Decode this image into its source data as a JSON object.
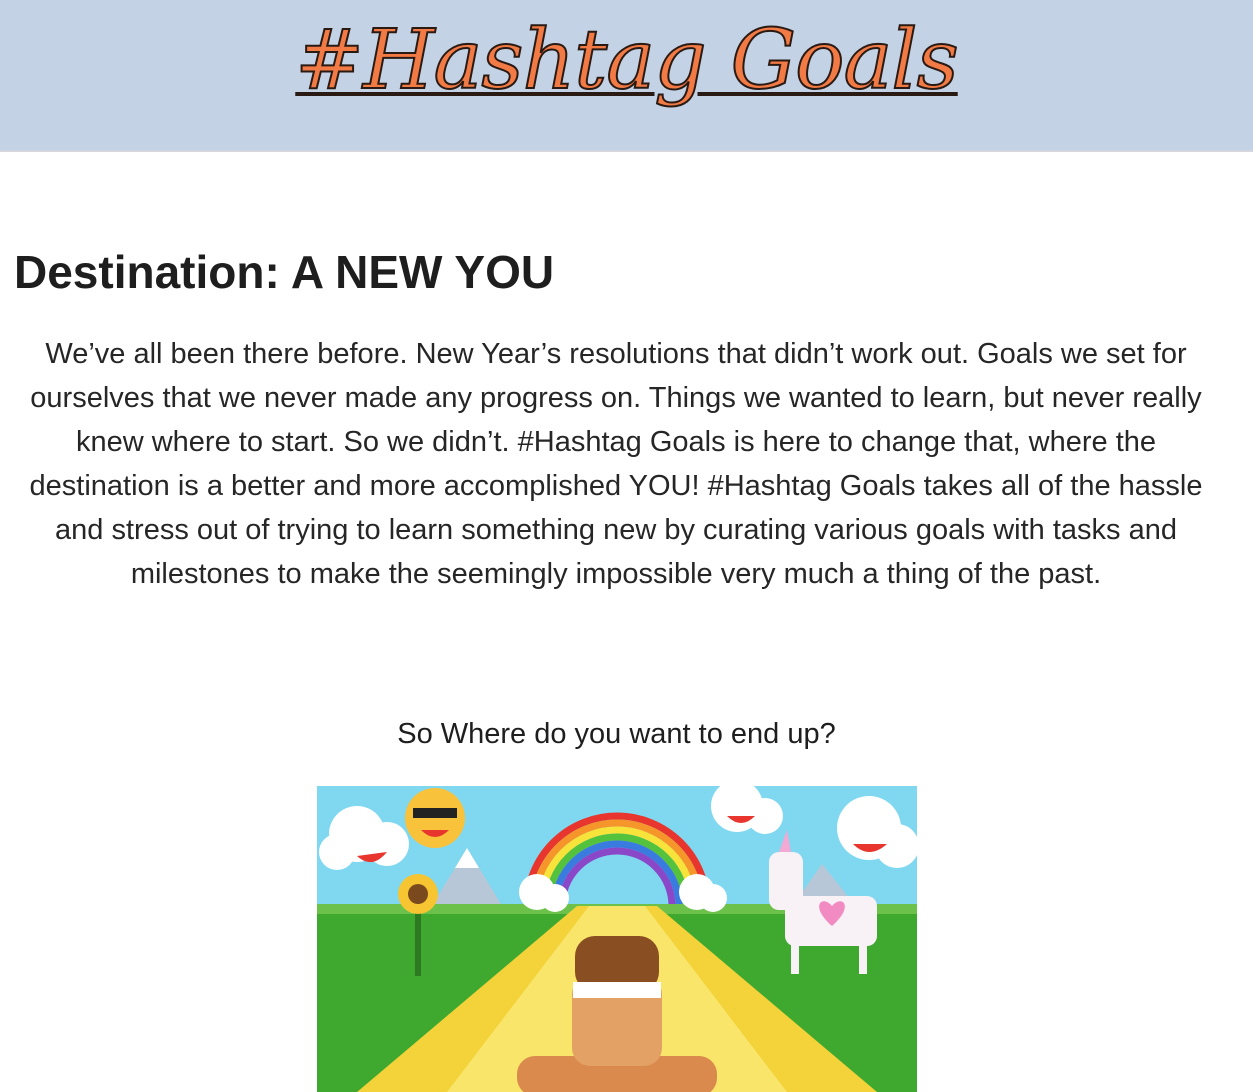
{
  "header": {
    "logo_text": "#Hashtag Goals"
  },
  "main": {
    "headline": "Destination: A NEW YOU",
    "intro": "We’ve all been there before. New Year’s resolutions that didn’t work out. Goals we set for ourselves that we never made any progress on. Things we wanted to learn, but never really knew where to start. So we didn’t. #Hashtag Goals is here to change that, where the destination is a better and more accomplished YOU! #Hashtag Goals takes all of the hassle and stress out of trying to learn something new by curating various goals with tasks and milestones to make the seemingly impossible very much a thing of the past.",
    "question": "So Where do you want to end up?"
  },
  "colors": {
    "header_bg": "#c3d2e4",
    "logo_fill": "#f27a45",
    "logo_outline": "#2a1a14",
    "text": "#222222"
  }
}
